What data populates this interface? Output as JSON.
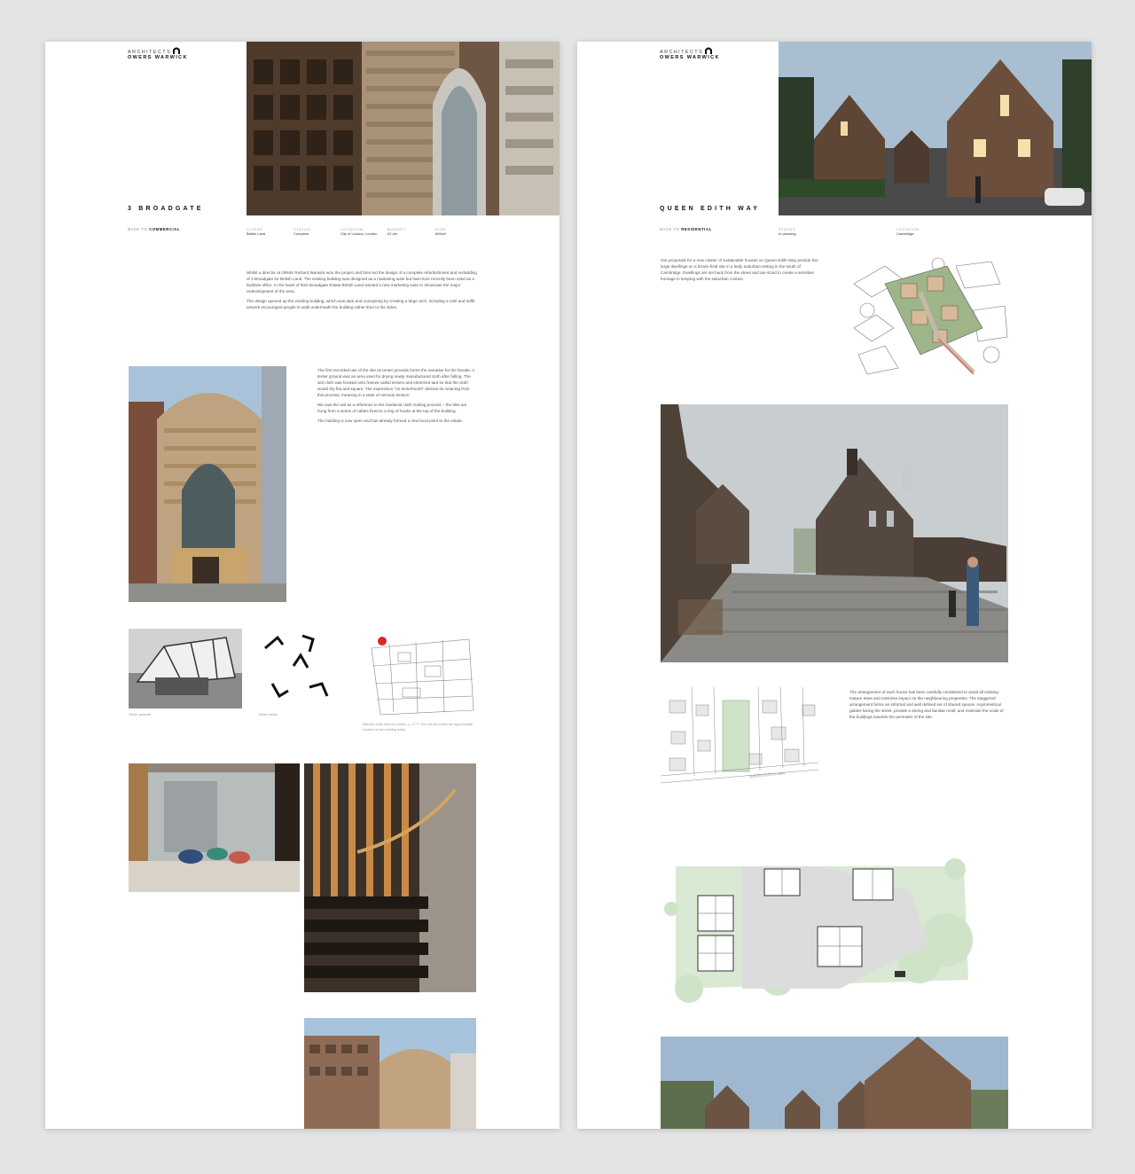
{
  "left": {
    "logo": {
      "top": "ARCHITECTS",
      "bottom": "OWERS WARWICK",
      "icon": "arch-logo-icon"
    },
    "title": "3 BROADGATE",
    "back": {
      "prefix": "BACK TO",
      "link": "COMMERCIAL"
    },
    "meta": [
      {
        "label": "CLIENT",
        "value": "British Land"
      },
      {
        "label": "STATUS",
        "value": "Complete"
      },
      {
        "label": "LOCATION",
        "value": "City of London, London"
      },
      {
        "label": "BUDGET",
        "value": "£2.4m"
      },
      {
        "label": "SIZE",
        "value": "800m2"
      }
    ],
    "intro": [
      "Whilst a director at ORMS Richard Warwick won the project and then led the design of a complete refurbishment and recladding of 3 Broadgate for British Land. The existing building was designed as a marketing suite but had more recently been used as a facilities office. In the heart of their Broadgate Estate British Land wanted a new marketing suite to showcase the major redevelopment of the area.",
      "The design opened up the existing building, which was dark and uninspiring by creating a large arch, including a café and soffit artwork encouraged people to walk underneath the building rather than to the sides."
    ],
    "body": [
      "The first recorded use of the site as tenter grounds forms the narrative for the facade. A tenter ground was an area used for drying newly manufactured cloth after fulling. The wet cloth was hooked onto frames called tenters and stretched taut so that the cloth would dry flat and square. The expression \"on tenterhooks\" derives its meaning from this process, meaning in a state of nervous tension.",
      "We saw the veil as a reference to the medieval cloth making process – the tiles are hung from a series of cables fixed to a ring of hooks at the top of the building.",
      "The building is now open and has already formed a new focal point to the estate."
    ],
    "captions": {
      "c1": "Tenter grounds",
      "c2": "Tenter hooks",
      "c3": "Bishops Gate area of London, c. 1777 The red dot marks the approximate location of the building today"
    }
  },
  "right": {
    "logo": {
      "top": "ARCHITECTS",
      "bottom": "OWERS WARWICK",
      "icon": "arch-logo-icon"
    },
    "title": "QUEEN EDITH WAY",
    "back": {
      "prefix": "BACK TO",
      "link": "RESIDENTIAL"
    },
    "meta": [
      {
        "label": "STATUS",
        "value": "In planning"
      },
      {
        "label": "LOCATION",
        "value": "Cambridge"
      }
    ],
    "intro": [
      "Our proposals for a new cluster of sustainable houses on Queen Edith Way provide five large dwellings on a brown-field site in a leafy suburban setting in the south of Cambridge. Dwellings are set back from the street and are sized to create a sensitive frontage in keeping with the suburban context."
    ],
    "body": [
      "The arrangement of each house has been carefully considered to avoid all existing mature trees and minimise impact on the neighbouring properties. The staggered arrangement forms an informal and well defined set of shared spaces. Asymmetrical gables facing the street, provide a strong and familiar motif, and minimise the scale of the buildings towards the perimeter of the site."
    ],
    "street_label": "QUEEN EDITH'S WAY"
  },
  "colors": {
    "background": "#e3e4e4",
    "panel": "#ffffff",
    "text": "#222222",
    "muted": "#999999",
    "plan_green": "#cfe3c8",
    "marker_red": "#d9262b"
  }
}
